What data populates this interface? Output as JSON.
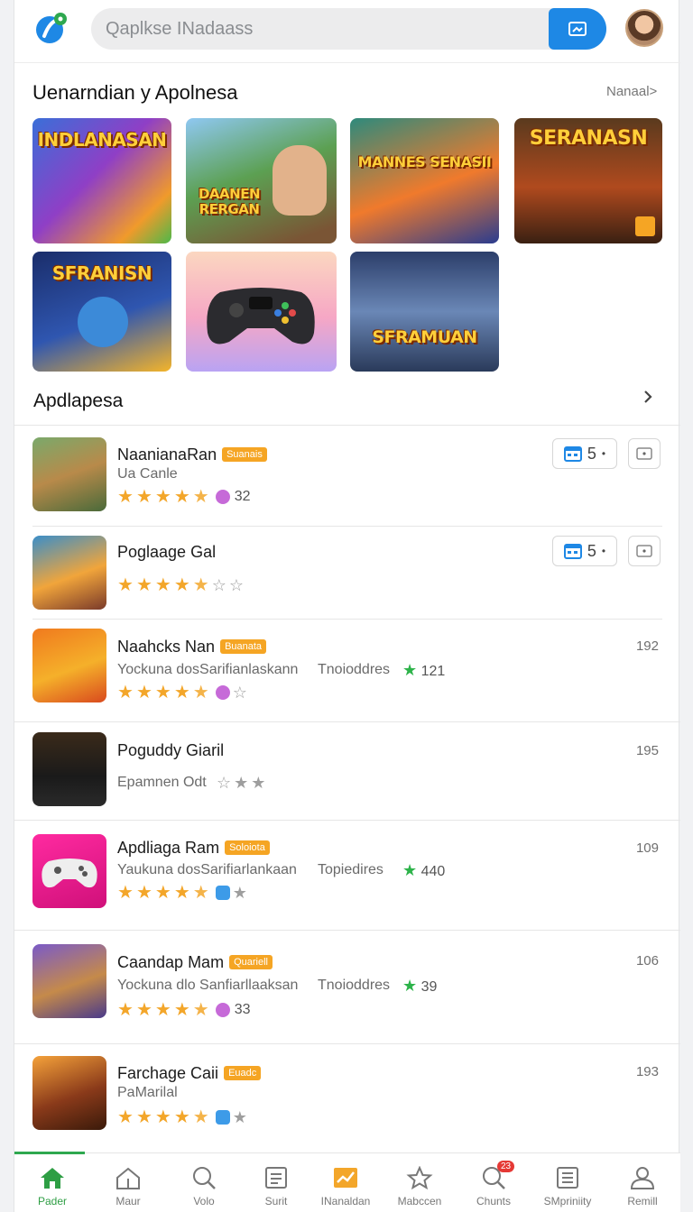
{
  "header": {
    "search_placeholder": "Qaplkse INadaass"
  },
  "featured": {
    "title": "Uenarndian y Apolnesa",
    "more": "Nanaal>",
    "tiles": [
      {
        "label": "INDLANASAN"
      },
      {
        "label": "DAANEN RERGAN"
      },
      {
        "label": "MANNES SENASII"
      },
      {
        "label": "SERANASN"
      },
      {
        "label": "SFRANISN"
      },
      {
        "label": ""
      },
      {
        "label": "SFRAMUAN"
      }
    ]
  },
  "apps_section": {
    "title": "Apdlapesa"
  },
  "apps": [
    {
      "title": "NaanianaRan",
      "badge": "Suanais",
      "sub": "Ua Canle",
      "extra": "",
      "rating_num": "32",
      "rank": "",
      "pill": "5"
    },
    {
      "title": "Poglaage Gal",
      "badge": "",
      "sub": "",
      "extra": "",
      "rating_num": "",
      "rank": "",
      "pill": "5"
    },
    {
      "title": "Naahcks Nan",
      "badge": "Buanata",
      "sub": "Yockuna dosSarifianlaskann",
      "extra": "Tnoioddres",
      "green": "121",
      "rank": "192"
    },
    {
      "title": "Poguddy Giaril",
      "badge": "",
      "sub": "Epamnen Odt",
      "extra": "",
      "rank": "195"
    },
    {
      "title": "Apdliaga Ram",
      "badge": "Soloiota",
      "sub": "Yaukuna dosSarifiarlankaan",
      "extra": "Topiedires",
      "green": "440",
      "rank": "109"
    },
    {
      "title": "Caandap Mam",
      "badge": "Quariell",
      "sub": "Yockuna dlo Sanfiarllaaksan",
      "extra": "Tnoioddres",
      "green": "39",
      "rating_num": "33",
      "rank": "106"
    },
    {
      "title": "Farchage Caii",
      "badge": "Euadc",
      "sub": "PaMarilal",
      "extra": "",
      "rank": "193"
    }
  ],
  "bottom_nav": [
    {
      "label": "Pader",
      "icon": "home-icon",
      "active": true
    },
    {
      "label": "Maur",
      "icon": "house-outline-icon"
    },
    {
      "label": "Volo",
      "icon": "search-icon"
    },
    {
      "label": "Surit",
      "icon": "document-icon"
    },
    {
      "label": "INanaldan",
      "icon": "chart-icon"
    },
    {
      "label": "Mabccen",
      "icon": "star-icon"
    },
    {
      "label": "Chunts",
      "icon": "search-icon",
      "badge": "23"
    },
    {
      "label": "SMpriniity",
      "icon": "list-icon"
    },
    {
      "label": "Remill",
      "icon": "person-icon"
    }
  ],
  "colors": {
    "accent": "#1e88e5",
    "active_nav": "#2ea84f",
    "star": "#f3a62a",
    "badge": "#f5a524"
  }
}
